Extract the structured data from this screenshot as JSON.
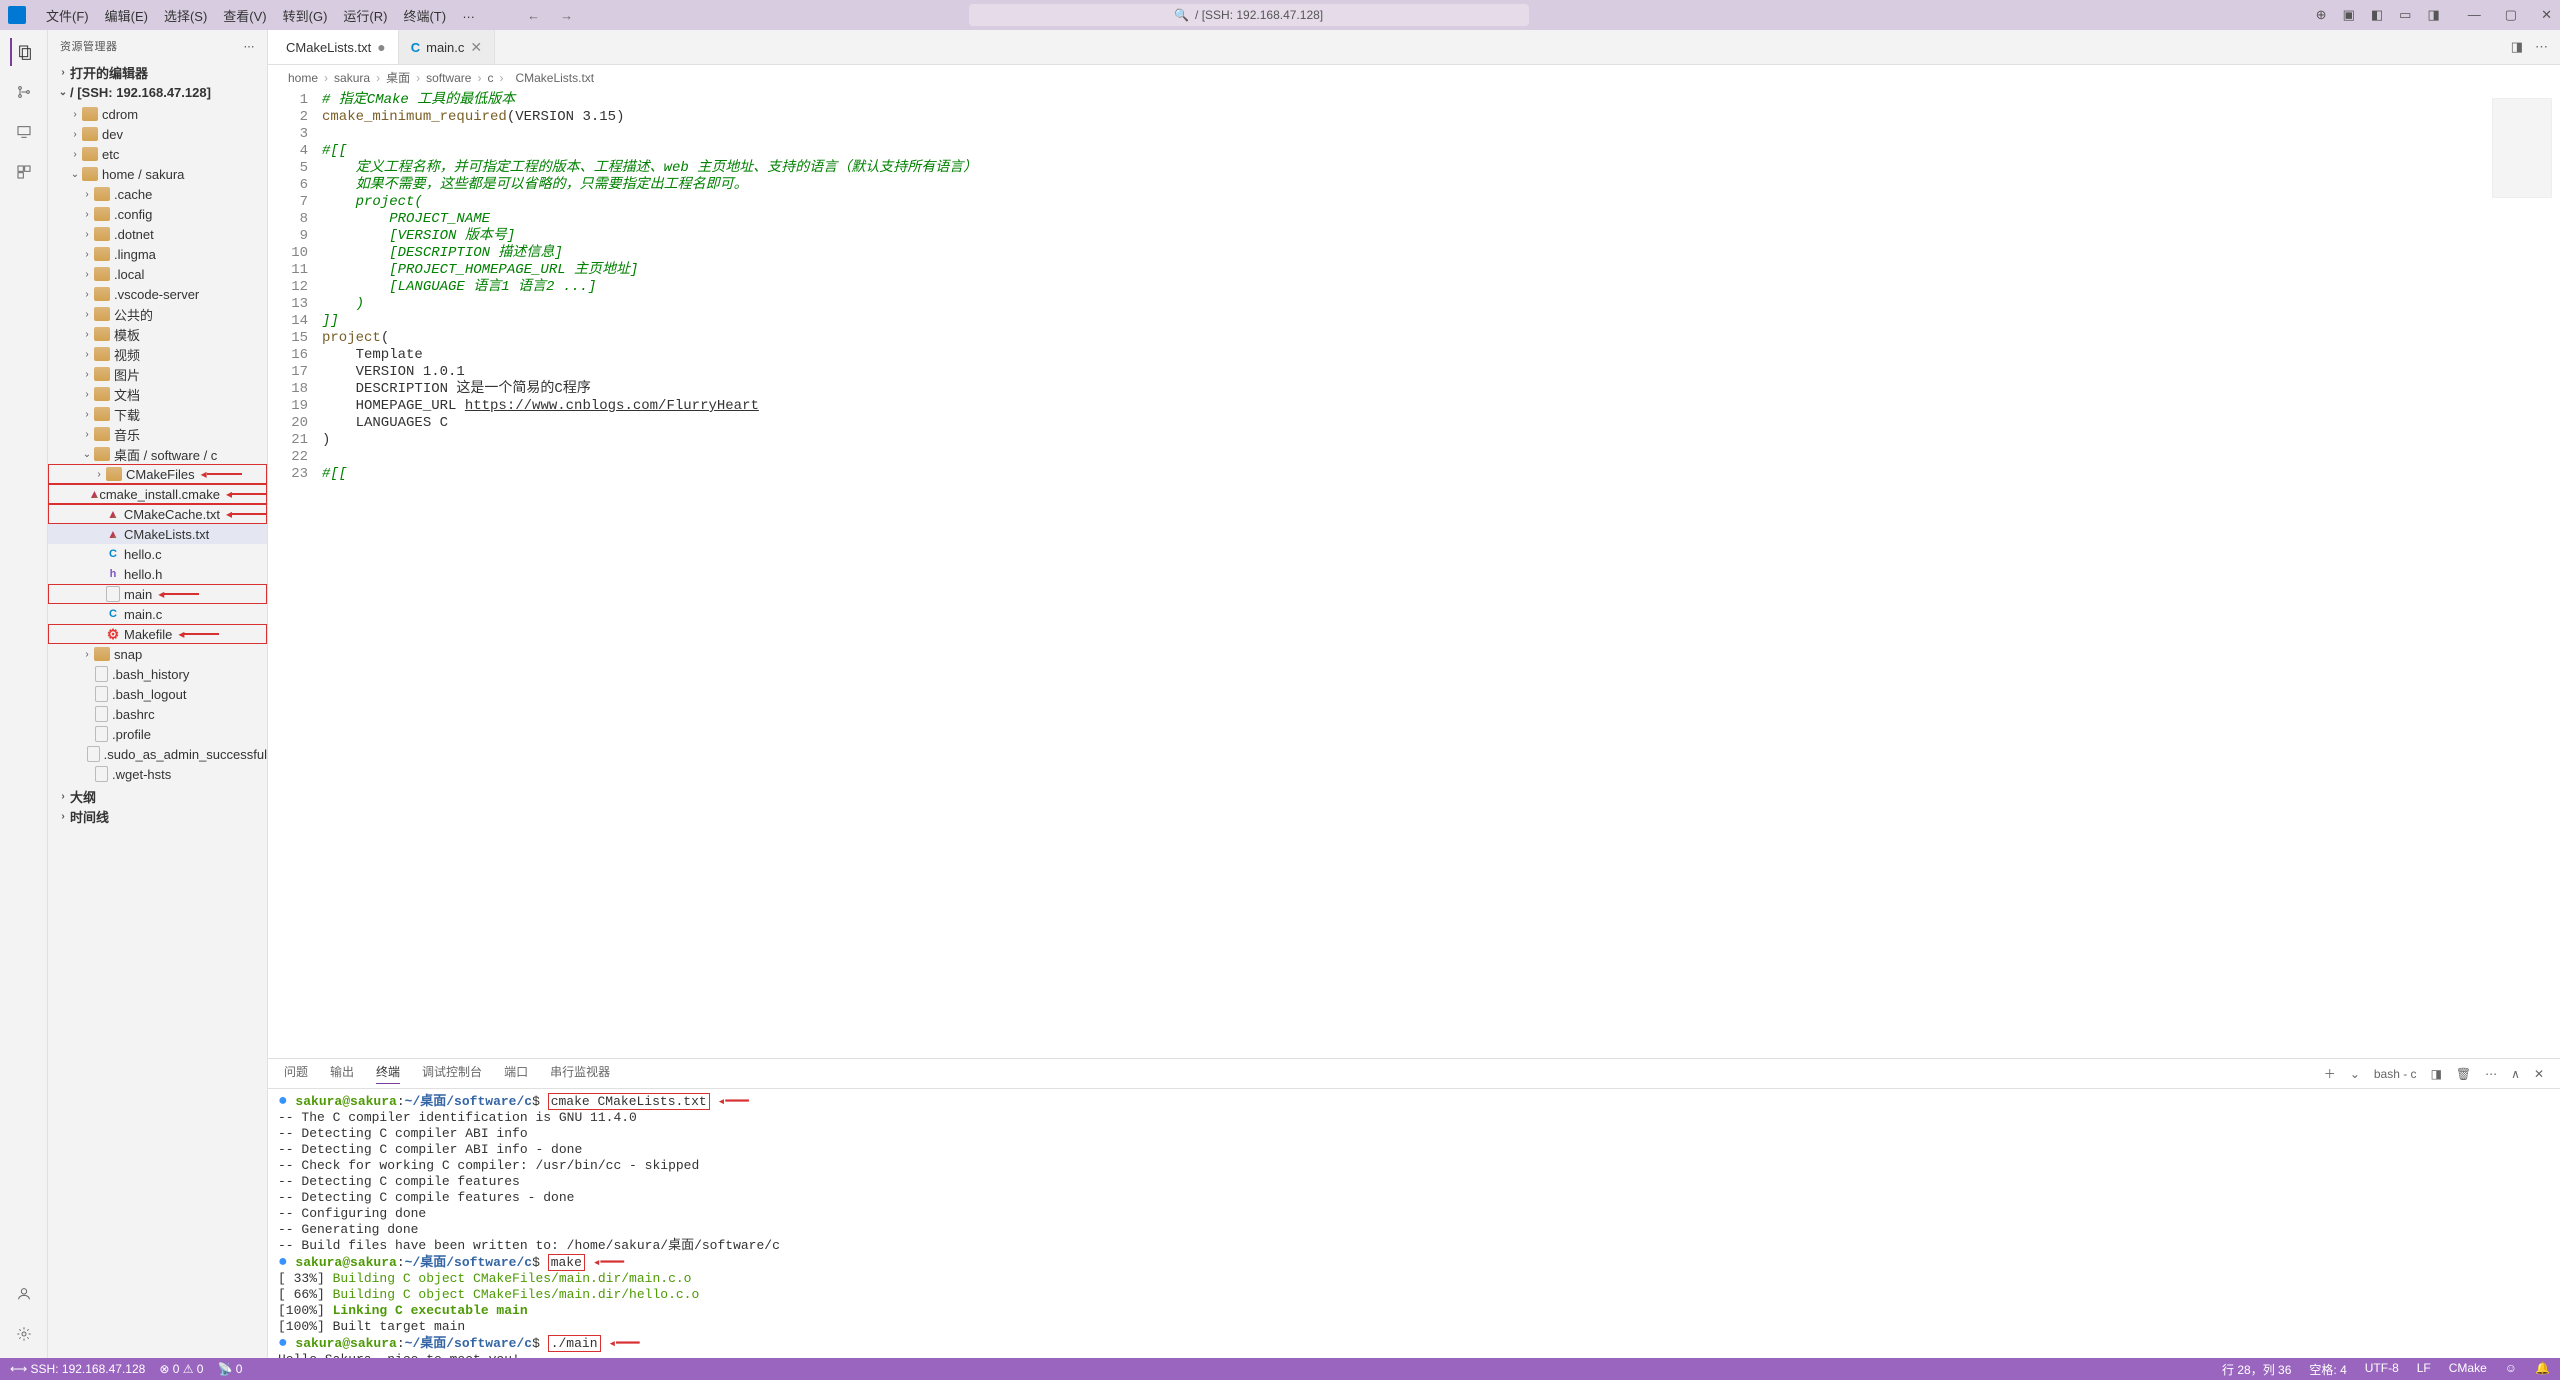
{
  "titlebar": {
    "menus": [
      "文件(F)",
      "编辑(E)",
      "选择(S)",
      "查看(V)",
      "转到(G)",
      "运行(R)",
      "终端(T)",
      "…"
    ],
    "search_text": "/ [SSH: 192.168.47.128]"
  },
  "sidebar": {
    "title": "资源管理器",
    "sections": {
      "open_editors": "打开的编辑器",
      "root": "/ [SSH: 192.168.47.128]",
      "outline": "大纲",
      "timeline": "时间线"
    },
    "tree": [
      {
        "indent": 1,
        "chevron": ">",
        "icon": "folder",
        "label": "cdrom"
      },
      {
        "indent": 1,
        "chevron": ">",
        "icon": "folder",
        "label": "dev"
      },
      {
        "indent": 1,
        "chevron": ">",
        "icon": "folder",
        "label": "etc"
      },
      {
        "indent": 1,
        "chevron": "v",
        "icon": "folder",
        "label": "home / sakura"
      },
      {
        "indent": 2,
        "chevron": ">",
        "icon": "folder",
        "label": ".cache"
      },
      {
        "indent": 2,
        "chevron": ">",
        "icon": "folder",
        "label": ".config"
      },
      {
        "indent": 2,
        "chevron": ">",
        "icon": "folder",
        "label": ".dotnet"
      },
      {
        "indent": 2,
        "chevron": ">",
        "icon": "folder",
        "label": ".lingma"
      },
      {
        "indent": 2,
        "chevron": ">",
        "icon": "folder",
        "label": ".local"
      },
      {
        "indent": 2,
        "chevron": ">",
        "icon": "folder",
        "label": ".vscode-server"
      },
      {
        "indent": 2,
        "chevron": ">",
        "icon": "folder",
        "label": "公共的"
      },
      {
        "indent": 2,
        "chevron": ">",
        "icon": "folder",
        "label": "模板"
      },
      {
        "indent": 2,
        "chevron": ">",
        "icon": "folder",
        "label": "视频"
      },
      {
        "indent": 2,
        "chevron": ">",
        "icon": "folder",
        "label": "图片"
      },
      {
        "indent": 2,
        "chevron": ">",
        "icon": "folder",
        "label": "文档"
      },
      {
        "indent": 2,
        "chevron": ">",
        "icon": "folder",
        "label": "下载"
      },
      {
        "indent": 2,
        "chevron": ">",
        "icon": "folder",
        "label": "音乐"
      },
      {
        "indent": 2,
        "chevron": "v",
        "icon": "folder",
        "label": "桌面 / software / c"
      },
      {
        "indent": 3,
        "chevron": ">",
        "icon": "folder",
        "label": "CMakeFiles",
        "highlighted": true,
        "arrow": true
      },
      {
        "indent": 3,
        "chevron": "",
        "icon": "cmake",
        "label": "cmake_install.cmake",
        "highlighted": true,
        "arrow": true
      },
      {
        "indent": 3,
        "chevron": "",
        "icon": "cmake",
        "label": "CMakeCache.txt",
        "highlighted": true,
        "arrow": true
      },
      {
        "indent": 3,
        "chevron": "",
        "icon": "cmake",
        "label": "CMakeLists.txt",
        "selected": true
      },
      {
        "indent": 3,
        "chevron": "",
        "icon": "c",
        "label": "hello.c"
      },
      {
        "indent": 3,
        "chevron": "",
        "icon": "h",
        "label": "hello.h"
      },
      {
        "indent": 3,
        "chevron": "",
        "icon": "exe",
        "label": "main",
        "highlighted": true,
        "arrow": true
      },
      {
        "indent": 3,
        "chevron": "",
        "icon": "c",
        "label": "main.c"
      },
      {
        "indent": 3,
        "chevron": "",
        "icon": "makefile",
        "label": "Makefile",
        "highlighted": true,
        "arrow": true
      },
      {
        "indent": 2,
        "chevron": ">",
        "icon": "folder",
        "label": "snap"
      },
      {
        "indent": 2,
        "chevron": "",
        "icon": "plain",
        "label": ".bash_history"
      },
      {
        "indent": 2,
        "chevron": "",
        "icon": "plain",
        "label": ".bash_logout"
      },
      {
        "indent": 2,
        "chevron": "",
        "icon": "plain",
        "label": ".bashrc"
      },
      {
        "indent": 2,
        "chevron": "",
        "icon": "plain",
        "label": ".profile"
      },
      {
        "indent": 2,
        "chevron": "",
        "icon": "plain",
        "label": ".sudo_as_admin_successful"
      },
      {
        "indent": 2,
        "chevron": "",
        "icon": "plain",
        "label": ".wget-hsts"
      }
    ]
  },
  "tabs": [
    {
      "icon": "cmake",
      "label": "CMakeLists.txt",
      "active": true,
      "dirty": true
    },
    {
      "icon": "c",
      "label": "main.c",
      "active": false
    }
  ],
  "breadcrumb": [
    "home",
    "sakura",
    "桌面",
    "software",
    "c",
    "CMakeLists.txt"
  ],
  "code_lines": [
    {
      "n": 1,
      "html": "<span class='cm-comment'># 指定CMake 工具的最低版本</span>"
    },
    {
      "n": 2,
      "html": "<span class='cm-func'>cmake_minimum_required</span><span class='cm-paren'>(</span>VERSION 3.15<span class='cm-paren'>)</span>"
    },
    {
      "n": 3,
      "html": ""
    },
    {
      "n": 4,
      "html": "<span class='cm-comment'>#[[</span>"
    },
    {
      "n": 5,
      "html": "<span class='cm-comment'>    定义工程名称，并可指定工程的版本、工程描述、web 主页地址、支持的语言（默认支持所有语言）</span>"
    },
    {
      "n": 6,
      "html": "<span class='cm-comment'>    如果不需要，这些都是可以省略的，只需要指定出工程名即可。</span>"
    },
    {
      "n": 7,
      "html": "<span class='cm-comment'>    project(</span>"
    },
    {
      "n": 8,
      "html": "<span class='cm-comment'>        PROJECT_NAME</span>"
    },
    {
      "n": 9,
      "html": "<span class='cm-comment'>        [VERSION 版本号]</span>"
    },
    {
      "n": 10,
      "html": "<span class='cm-comment'>        [DESCRIPTION 描述信息]</span>"
    },
    {
      "n": 11,
      "html": "<span class='cm-comment'>        [PROJECT_HOMEPAGE_URL 主页地址]</span>"
    },
    {
      "n": 12,
      "html": "<span class='cm-comment'>        [LANGUAGE 语言1 语言2 ...]</span>"
    },
    {
      "n": 13,
      "html": "<span class='cm-comment'>    )</span>"
    },
    {
      "n": 14,
      "html": "<span class='cm-comment'>]]</span>"
    },
    {
      "n": 15,
      "html": "<span class='cm-func'>project</span><span class='cm-paren'>(</span>"
    },
    {
      "n": 16,
      "html": "    Template"
    },
    {
      "n": 17,
      "html": "    VERSION 1.0.1"
    },
    {
      "n": 18,
      "html": "    DESCRIPTION 这是一个简易的C程序"
    },
    {
      "n": 19,
      "html": "    HOMEPAGE_URL <span class='cm-url'>https://www.cnblogs.com/FlurryHeart</span>"
    },
    {
      "n": 20,
      "html": "    LANGUAGES C"
    },
    {
      "n": 21,
      "html": "<span class='cm-paren'>)</span>"
    },
    {
      "n": 22,
      "html": ""
    },
    {
      "n": 23,
      "html": "<span class='cm-comment'>#[[</span>"
    }
  ],
  "panel": {
    "tabs": [
      "问题",
      "输出",
      "终端",
      "调试控制台",
      "端口",
      "串行监视器"
    ],
    "active_tab": "终端",
    "shell_label": "bash - c"
  },
  "terminal": {
    "user": "sakura@sakura",
    "path": "~/桌面/software/c",
    "lines": [
      {
        "type": "cmd",
        "cmd": "cmake CMakeLists.txt",
        "box": true,
        "arrow": true,
        "dot": "blue"
      },
      {
        "type": "out",
        "text": "-- The C compiler identification is GNU 11.4.0"
      },
      {
        "type": "out",
        "text": "-- Detecting C compiler ABI info"
      },
      {
        "type": "out",
        "text": "-- Detecting C compiler ABI info - done"
      },
      {
        "type": "out",
        "text": "-- Check for working C compiler: /usr/bin/cc - skipped"
      },
      {
        "type": "out",
        "text": "-- Detecting C compile features"
      },
      {
        "type": "out",
        "text": "-- Detecting C compile features - done"
      },
      {
        "type": "out",
        "text": "-- Configuring done"
      },
      {
        "type": "out",
        "text": "-- Generating done"
      },
      {
        "type": "out",
        "text": "-- Build files have been written to: /home/sakura/桌面/software/c"
      },
      {
        "type": "cmd",
        "cmd": "make",
        "box": true,
        "arrow": true,
        "dot": "blue"
      },
      {
        "type": "build",
        "pct": "[ 33%]",
        "text": "Building C object CMakeFiles/main.dir/main.c.o"
      },
      {
        "type": "build",
        "pct": "[ 66%]",
        "text": "Building C object CMakeFiles/main.dir/hello.c.o"
      },
      {
        "type": "build",
        "pct": "[100%]",
        "text": "Linking C executable main",
        "bold": true
      },
      {
        "type": "out",
        "text": "[100%] Built target main"
      },
      {
        "type": "cmd",
        "cmd": "./main",
        "box": true,
        "arrow": true,
        "dot": "blue"
      },
      {
        "type": "out",
        "text": "Hello Sakura, nice to meet you!"
      },
      {
        "type": "cmd",
        "cmd": "",
        "cursor": true,
        "dot": "hollow"
      }
    ]
  },
  "statusbar": {
    "left": [
      "SSH: 192.168.47.128",
      "⊗ 0 ⚠ 0",
      "📡 0"
    ],
    "right": [
      "行 28，列 36",
      "空格: 4",
      "UTF-8",
      "LF",
      "CMake"
    ]
  }
}
